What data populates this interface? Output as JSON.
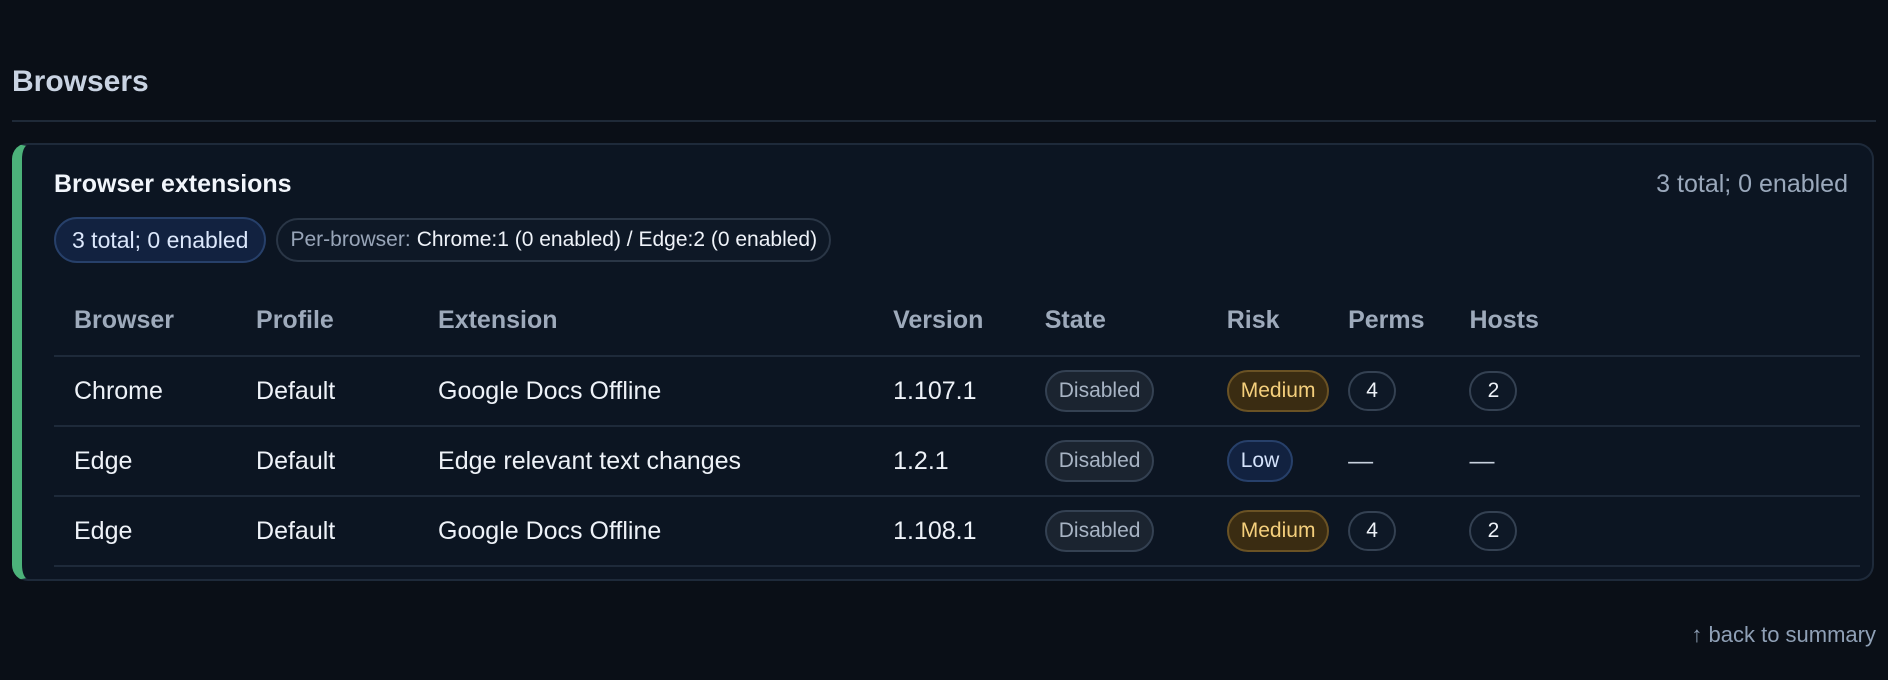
{
  "section": {
    "title": "Browsers"
  },
  "card": {
    "title": "Browser extensions",
    "summary_right": "3 total; 0 enabled",
    "pill_total": "3 total; 0 enabled",
    "per_browser_label": "Per-browser:",
    "per_browser_value": "Chrome:1 (0 enabled) / Edge:2 (0 enabled)",
    "accent_color": "#4cb27a"
  },
  "table": {
    "columns": [
      "Browser",
      "Profile",
      "Extension",
      "Version",
      "State",
      "Risk",
      "Perms",
      "Hosts"
    ],
    "rows": [
      {
        "browser": "Chrome",
        "profile": "Default",
        "extension": "Google Docs Offline",
        "version": "1.107.1",
        "state": "Disabled",
        "risk": "Medium",
        "perms": "4",
        "hosts": "2"
      },
      {
        "browser": "Edge",
        "profile": "Default",
        "extension": "Edge relevant text changes",
        "version": "1.2.1",
        "state": "Disabled",
        "risk": "Low",
        "perms": "—",
        "hosts": "—"
      },
      {
        "browser": "Edge",
        "profile": "Default",
        "extension": "Google Docs Offline",
        "version": "1.108.1",
        "state": "Disabled",
        "risk": "Medium",
        "perms": "4",
        "hosts": "2"
      }
    ]
  },
  "footer": {
    "back_link": "↑ back to summary"
  },
  "colors": {
    "background": "#0a0f17",
    "risk_medium": "#f4cf7c",
    "risk_low": "#d5e3fb",
    "accent": "#4cb27a"
  }
}
